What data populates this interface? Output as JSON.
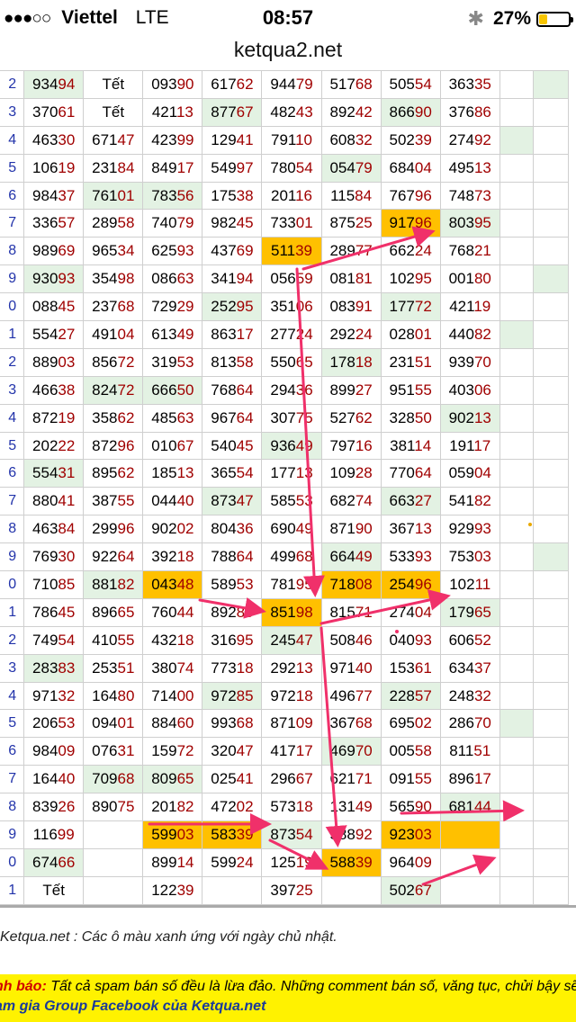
{
  "status": {
    "signal": "●●●○○",
    "carrier": "Viettel",
    "network": "LTE",
    "time": "08:57",
    "bluetooth": "✱",
    "battery": "27%",
    "battery_level": 0.27
  },
  "url": "ketqua2.net",
  "days": [
    "2",
    "3",
    "4",
    "5",
    "6",
    "7",
    "8",
    "9",
    "0",
    "1",
    "2",
    "3",
    "4",
    "5",
    "6",
    "7",
    "8",
    "9",
    "0",
    "1",
    "2",
    "3",
    "4",
    "5",
    "6",
    "7",
    "8",
    "9",
    "0",
    "1"
  ],
  "rows": [
    [
      [
        "93494",
        "g"
      ],
      [
        "Tết",
        ""
      ],
      [
        "09390",
        ""
      ],
      [
        "61762",
        ""
      ],
      [
        "94479",
        ""
      ],
      [
        "51768",
        ""
      ],
      [
        "50554",
        ""
      ],
      [
        "36335",
        ""
      ],
      [
        "",
        ""
      ],
      [
        "",
        "g"
      ]
    ],
    [
      [
        "37061",
        ""
      ],
      [
        "Tết",
        ""
      ],
      [
        "42113",
        ""
      ],
      [
        "87767",
        "g"
      ],
      [
        "48243",
        ""
      ],
      [
        "89242",
        ""
      ],
      [
        "86690",
        "g"
      ],
      [
        "37686",
        ""
      ],
      [
        "",
        ""
      ],
      [
        "",
        ""
      ]
    ],
    [
      [
        "46330",
        ""
      ],
      [
        "67147",
        ""
      ],
      [
        "42399",
        ""
      ],
      [
        "12941",
        ""
      ],
      [
        "79110",
        ""
      ],
      [
        "60832",
        ""
      ],
      [
        "50239",
        ""
      ],
      [
        "27492",
        ""
      ],
      [
        "",
        "g"
      ],
      [
        "",
        ""
      ]
    ],
    [
      [
        "10619",
        ""
      ],
      [
        "23184",
        ""
      ],
      [
        "84917",
        ""
      ],
      [
        "54997",
        ""
      ],
      [
        "78054",
        ""
      ],
      [
        "05479",
        "g"
      ],
      [
        "68404",
        ""
      ],
      [
        "49513",
        ""
      ],
      [
        "",
        ""
      ],
      [
        "",
        ""
      ]
    ],
    [
      [
        "98437",
        ""
      ],
      [
        "76101",
        "g"
      ],
      [
        "78356",
        "g"
      ],
      [
        "17538",
        ""
      ],
      [
        "20116",
        ""
      ],
      [
        "11584",
        ""
      ],
      [
        "76796",
        ""
      ],
      [
        "74873",
        ""
      ],
      [
        "",
        ""
      ],
      [
        "",
        ""
      ]
    ],
    [
      [
        "33657",
        ""
      ],
      [
        "28958",
        ""
      ],
      [
        "74079",
        ""
      ],
      [
        "98245",
        ""
      ],
      [
        "73301",
        ""
      ],
      [
        "87525",
        ""
      ],
      [
        "91796",
        "o"
      ],
      [
        "80395",
        "g"
      ],
      [
        "",
        ""
      ],
      [
        "",
        ""
      ]
    ],
    [
      [
        "98969",
        ""
      ],
      [
        "96534",
        ""
      ],
      [
        "62593",
        ""
      ],
      [
        "43769",
        ""
      ],
      [
        "51139",
        "o"
      ],
      [
        "28977",
        ""
      ],
      [
        "66224",
        ""
      ],
      [
        "76821",
        ""
      ],
      [
        "",
        ""
      ],
      [
        "",
        ""
      ]
    ],
    [
      [
        "93093",
        "g"
      ],
      [
        "35498",
        ""
      ],
      [
        "08663",
        ""
      ],
      [
        "34194",
        ""
      ],
      [
        "05659",
        ""
      ],
      [
        "08181",
        ""
      ],
      [
        "10295",
        ""
      ],
      [
        "00180",
        ""
      ],
      [
        "",
        ""
      ],
      [
        "",
        "g"
      ]
    ],
    [
      [
        "08845",
        ""
      ],
      [
        "23768",
        ""
      ],
      [
        "72929",
        ""
      ],
      [
        "25295",
        "g"
      ],
      [
        "35106",
        ""
      ],
      [
        "08391",
        ""
      ],
      [
        "17772",
        "g"
      ],
      [
        "42119",
        ""
      ],
      [
        "",
        ""
      ],
      [
        "",
        ""
      ]
    ],
    [
      [
        "55427",
        ""
      ],
      [
        "49104",
        ""
      ],
      [
        "61349",
        ""
      ],
      [
        "86317",
        ""
      ],
      [
        "27724",
        ""
      ],
      [
        "29224",
        ""
      ],
      [
        "02801",
        ""
      ],
      [
        "44082",
        ""
      ],
      [
        "",
        "g"
      ],
      [
        "",
        ""
      ]
    ],
    [
      [
        "88903",
        ""
      ],
      [
        "85672",
        ""
      ],
      [
        "31953",
        ""
      ],
      [
        "81358",
        ""
      ],
      [
        "55065",
        ""
      ],
      [
        "17818",
        "g"
      ],
      [
        "23151",
        ""
      ],
      [
        "93970",
        ""
      ],
      [
        "",
        ""
      ],
      [
        "",
        ""
      ]
    ],
    [
      [
        "46638",
        ""
      ],
      [
        "82472",
        "g"
      ],
      [
        "66650",
        "g"
      ],
      [
        "76864",
        ""
      ],
      [
        "29436",
        ""
      ],
      [
        "89927",
        ""
      ],
      [
        "95155",
        ""
      ],
      [
        "40306",
        ""
      ],
      [
        "",
        ""
      ],
      [
        "",
        ""
      ]
    ],
    [
      [
        "87219",
        ""
      ],
      [
        "35862",
        ""
      ],
      [
        "48563",
        ""
      ],
      [
        "96764",
        ""
      ],
      [
        "30775",
        ""
      ],
      [
        "52762",
        ""
      ],
      [
        "32850",
        ""
      ],
      [
        "90213",
        "g"
      ],
      [
        "",
        ""
      ],
      [
        "",
        ""
      ]
    ],
    [
      [
        "20222",
        ""
      ],
      [
        "87296",
        ""
      ],
      [
        "01067",
        ""
      ],
      [
        "54045",
        ""
      ],
      [
        "93649",
        "g"
      ],
      [
        "79716",
        ""
      ],
      [
        "38114",
        ""
      ],
      [
        "19117",
        ""
      ],
      [
        "",
        ""
      ],
      [
        "",
        ""
      ]
    ],
    [
      [
        "55431",
        "g"
      ],
      [
        "89562",
        ""
      ],
      [
        "18513",
        ""
      ],
      [
        "36554",
        ""
      ],
      [
        "17713",
        ""
      ],
      [
        "10928",
        ""
      ],
      [
        "77064",
        ""
      ],
      [
        "05904",
        ""
      ],
      [
        "",
        ""
      ],
      [
        "",
        ""
      ]
    ],
    [
      [
        "88041",
        ""
      ],
      [
        "38755",
        ""
      ],
      [
        "04440",
        ""
      ],
      [
        "87347",
        "g"
      ],
      [
        "58553",
        ""
      ],
      [
        "68274",
        ""
      ],
      [
        "66327",
        "g"
      ],
      [
        "54182",
        ""
      ],
      [
        "",
        ""
      ],
      [
        "",
        ""
      ]
    ],
    [
      [
        "46384",
        ""
      ],
      [
        "29996",
        ""
      ],
      [
        "90202",
        ""
      ],
      [
        "80436",
        ""
      ],
      [
        "69049",
        ""
      ],
      [
        "87190",
        ""
      ],
      [
        "36713",
        ""
      ],
      [
        "92993",
        ""
      ],
      [
        "",
        ""
      ],
      [
        "",
        ""
      ]
    ],
    [
      [
        "76930",
        ""
      ],
      [
        "92264",
        ""
      ],
      [
        "39218",
        ""
      ],
      [
        "78864",
        ""
      ],
      [
        "49968",
        ""
      ],
      [
        "66449",
        "g"
      ],
      [
        "53393",
        ""
      ],
      [
        "75303",
        ""
      ],
      [
        "",
        ""
      ],
      [
        "",
        "g"
      ]
    ],
    [
      [
        "71085",
        ""
      ],
      [
        "88182",
        "g"
      ],
      [
        "04348",
        "o"
      ],
      [
        "58953",
        ""
      ],
      [
        "78195",
        ""
      ],
      [
        "71808",
        "o"
      ],
      [
        "25496",
        "o"
      ],
      [
        "10211",
        ""
      ],
      [
        "",
        ""
      ],
      [
        "",
        ""
      ]
    ],
    [
      [
        "78645",
        ""
      ],
      [
        "89665",
        ""
      ],
      [
        "76044",
        ""
      ],
      [
        "89280",
        ""
      ],
      [
        "85198",
        "o"
      ],
      [
        "81571",
        ""
      ],
      [
        "27404",
        ""
      ],
      [
        "17965",
        "g"
      ],
      [
        "",
        ""
      ],
      [
        "",
        ""
      ]
    ],
    [
      [
        "74954",
        ""
      ],
      [
        "41055",
        ""
      ],
      [
        "43218",
        ""
      ],
      [
        "31695",
        ""
      ],
      [
        "24547",
        "g"
      ],
      [
        "50846",
        ""
      ],
      [
        "04093",
        ""
      ],
      [
        "60652",
        ""
      ],
      [
        "",
        ""
      ],
      [
        "",
        ""
      ]
    ],
    [
      [
        "28383",
        "g"
      ],
      [
        "25351",
        ""
      ],
      [
        "38074",
        ""
      ],
      [
        "77318",
        ""
      ],
      [
        "29213",
        ""
      ],
      [
        "97140",
        ""
      ],
      [
        "15361",
        ""
      ],
      [
        "63437",
        ""
      ],
      [
        "",
        ""
      ],
      [
        "",
        ""
      ]
    ],
    [
      [
        "97132",
        ""
      ],
      [
        "16480",
        ""
      ],
      [
        "71400",
        ""
      ],
      [
        "97285",
        "g"
      ],
      [
        "97218",
        ""
      ],
      [
        "49677",
        ""
      ],
      [
        "22857",
        "g"
      ],
      [
        "24832",
        ""
      ],
      [
        "",
        ""
      ],
      [
        "",
        ""
      ]
    ],
    [
      [
        "20653",
        ""
      ],
      [
        "09401",
        ""
      ],
      [
        "88460",
        ""
      ],
      [
        "99368",
        ""
      ],
      [
        "87109",
        ""
      ],
      [
        "36768",
        ""
      ],
      [
        "69502",
        ""
      ],
      [
        "28670",
        ""
      ],
      [
        "",
        "g"
      ],
      [
        "",
        ""
      ]
    ],
    [
      [
        "98409",
        ""
      ],
      [
        "07631",
        ""
      ],
      [
        "15972",
        ""
      ],
      [
        "32047",
        ""
      ],
      [
        "41717",
        ""
      ],
      [
        "46970",
        "g"
      ],
      [
        "00558",
        ""
      ],
      [
        "81151",
        ""
      ],
      [
        "",
        ""
      ],
      [
        "",
        ""
      ]
    ],
    [
      [
        "16440",
        ""
      ],
      [
        "70968",
        "g"
      ],
      [
        "80965",
        "g"
      ],
      [
        "02541",
        ""
      ],
      [
        "29667",
        ""
      ],
      [
        "62171",
        ""
      ],
      [
        "09155",
        ""
      ],
      [
        "89617",
        ""
      ],
      [
        "",
        ""
      ],
      [
        "",
        ""
      ]
    ],
    [
      [
        "83926",
        ""
      ],
      [
        "89075",
        ""
      ],
      [
        "20182",
        ""
      ],
      [
        "47202",
        ""
      ],
      [
        "57318",
        ""
      ],
      [
        "13149",
        ""
      ],
      [
        "56590",
        ""
      ],
      [
        "68144",
        "g"
      ],
      [
        "",
        ""
      ],
      [
        "",
        ""
      ]
    ],
    [
      [
        "11699",
        ""
      ],
      [
        "",
        ""
      ],
      [
        "59903",
        "o"
      ],
      [
        "58339",
        "o"
      ],
      [
        "87354",
        "g"
      ],
      [
        "58892",
        ""
      ],
      [
        "92303",
        "o"
      ],
      [
        "",
        "o"
      ],
      [
        "",
        ""
      ],
      [
        "",
        ""
      ]
    ],
    [
      [
        "67466",
        "g"
      ],
      [
        "",
        ""
      ],
      [
        "89914",
        ""
      ],
      [
        "59924",
        ""
      ],
      [
        "12519",
        ""
      ],
      [
        "58839",
        "o"
      ],
      [
        "96409",
        ""
      ],
      [
        "",
        ""
      ],
      [
        "",
        ""
      ],
      [
        "",
        ""
      ]
    ],
    [
      [
        "Tết",
        ""
      ],
      [
        "",
        ""
      ],
      [
        "12239",
        ""
      ],
      [
        "",
        ""
      ],
      [
        "39725",
        ""
      ],
      [
        "",
        ""
      ],
      [
        "50267",
        "g"
      ],
      [
        "",
        ""
      ],
      [
        "",
        ""
      ],
      [
        "",
        ""
      ]
    ]
  ],
  "note": "Ketqua.net : Các ô màu xanh ứng với ngày chủ nhật.",
  "warning_label": "nh báo:",
  "warning_text": "Tất cả spam bán số đều là lừa đảo. Những comment bán số, văng tục, chửi bậy sẽ",
  "group_text": "am gia Group Facebook của Ketqua.net",
  "colors": {
    "green": "#e3f2e3",
    "orange": "#ffc000",
    "arrow": "#f0306a",
    "day": "#2233aa",
    "tail": "#a00000",
    "warn": "#fff200"
  }
}
